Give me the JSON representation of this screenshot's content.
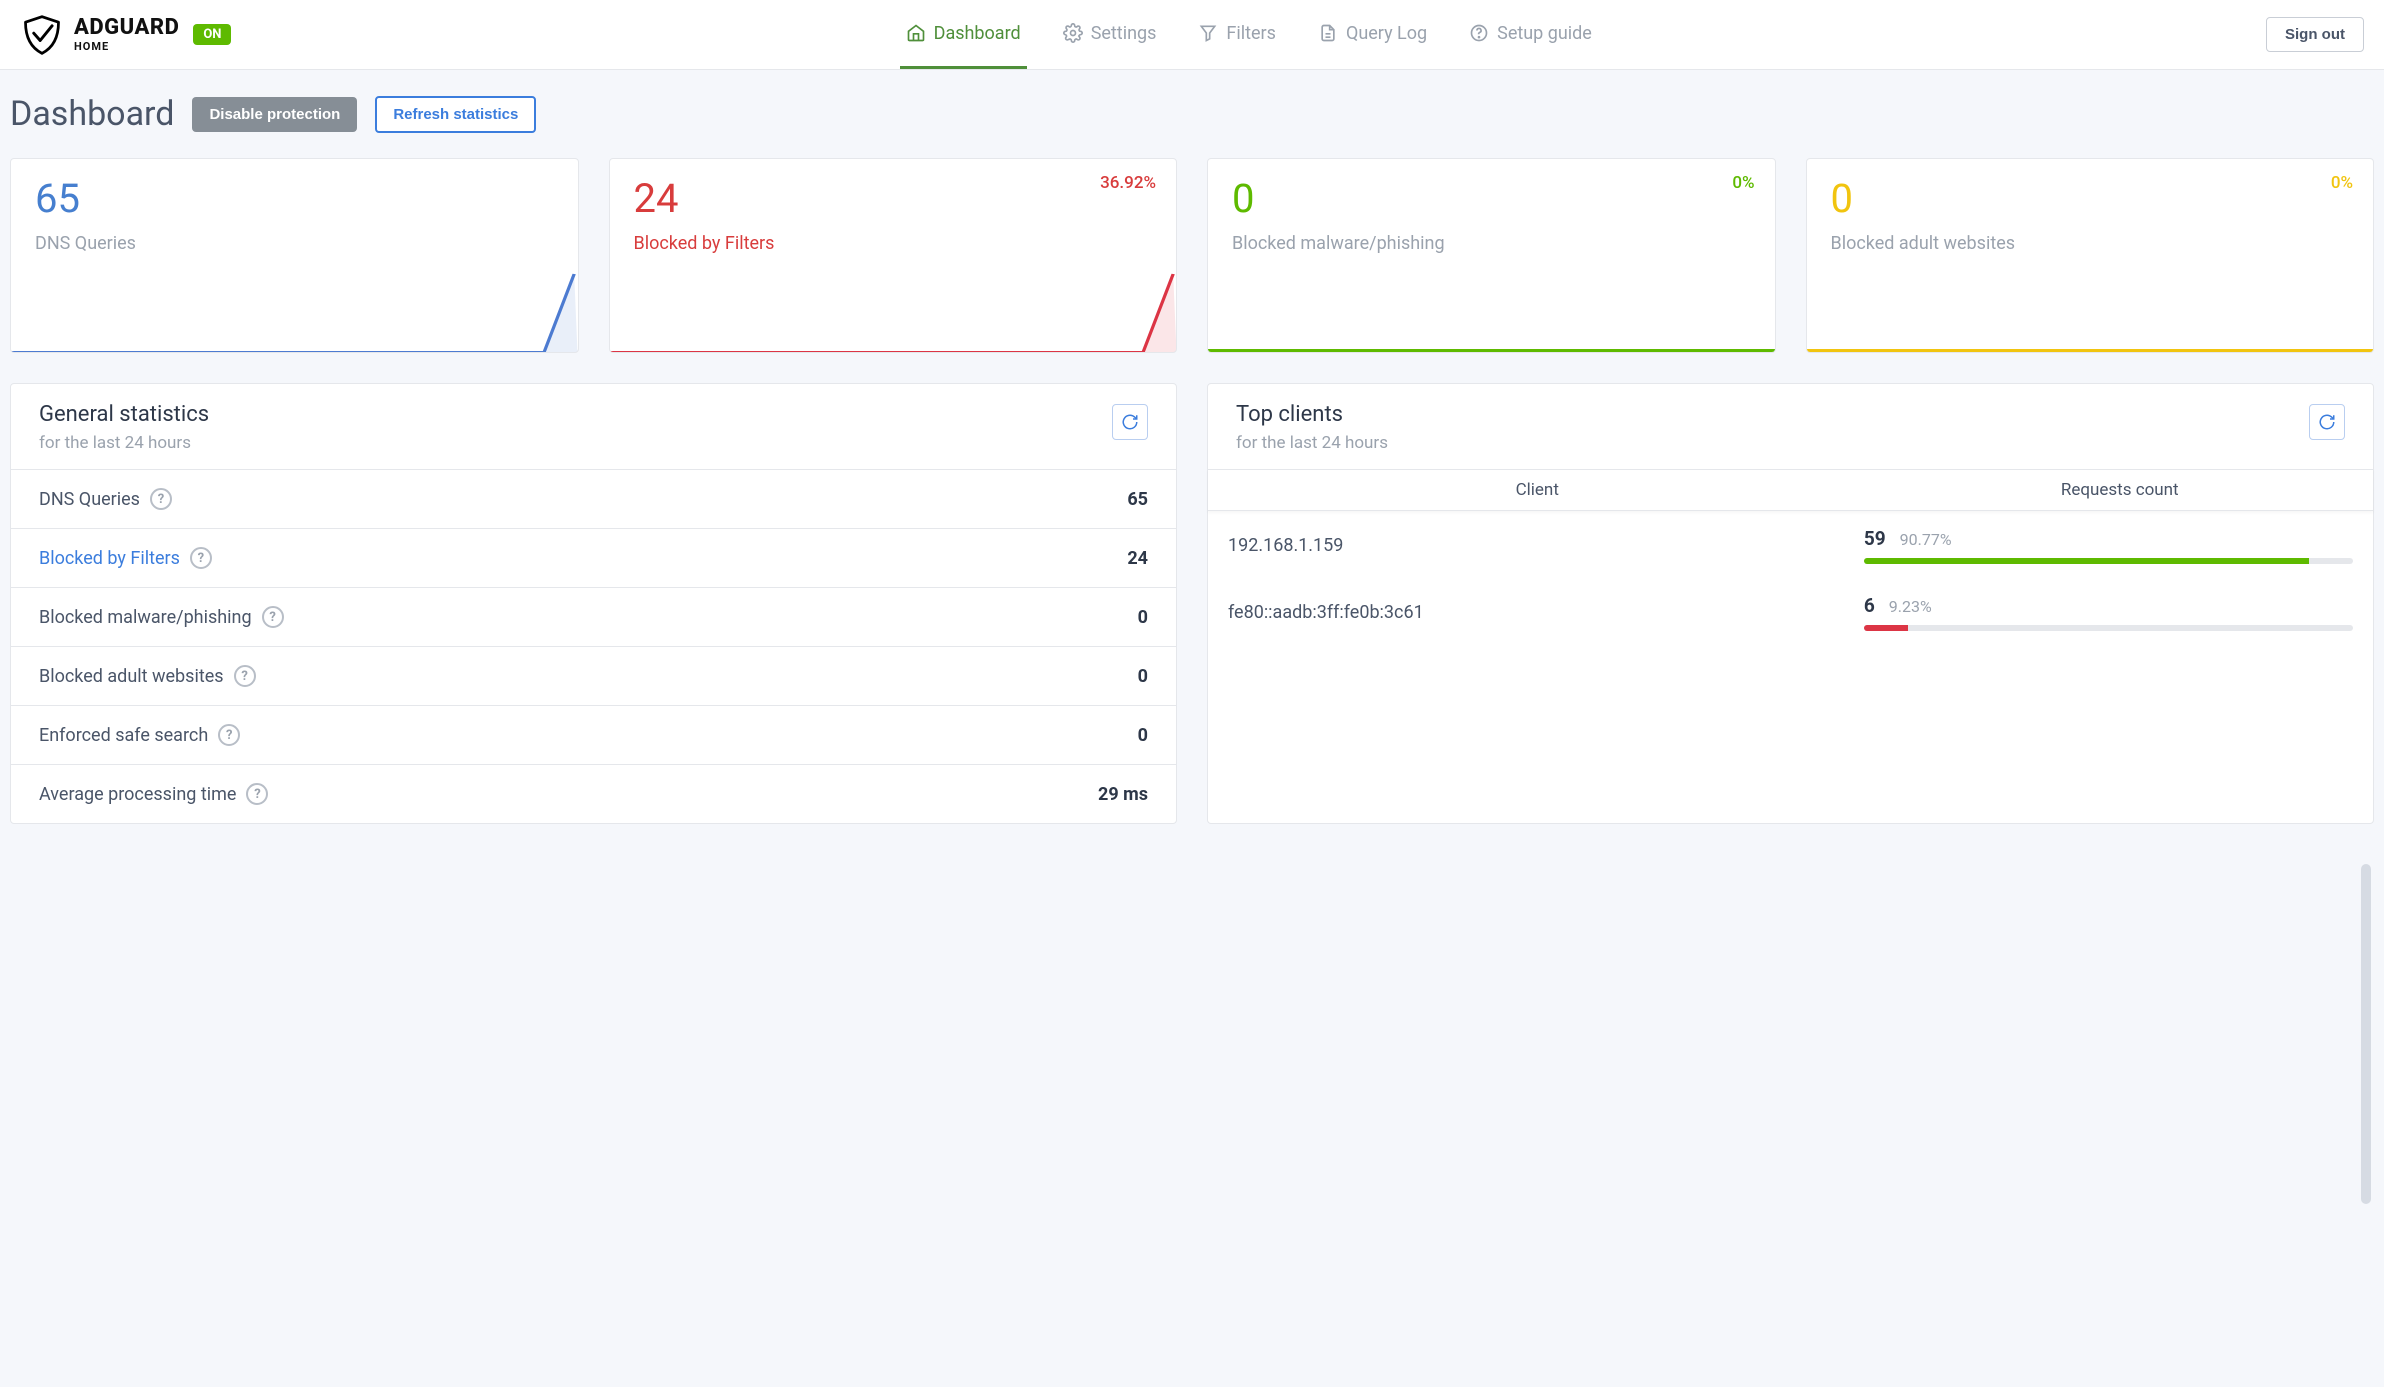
{
  "header": {
    "brand_title": "ADGUARD",
    "brand_sub": "HOME",
    "status": "ON",
    "nav": [
      {
        "label": "Dashboard",
        "active": true
      },
      {
        "label": "Settings",
        "active": false
      },
      {
        "label": "Filters",
        "active": false
      },
      {
        "label": "Query Log",
        "active": false
      },
      {
        "label": "Setup guide",
        "active": false
      }
    ],
    "sign_out": "Sign out"
  },
  "page": {
    "title": "Dashboard",
    "disable_btn": "Disable protection",
    "refresh_btn": "Refresh statistics"
  },
  "cards": [
    {
      "color": "blue",
      "value": "65",
      "label": "DNS Queries",
      "pct": ""
    },
    {
      "color": "red",
      "value": "24",
      "label": "Blocked by Filters",
      "pct": "36.92%"
    },
    {
      "color": "green",
      "value": "0",
      "label": "Blocked malware/phishing",
      "pct": "0%"
    },
    {
      "color": "yellow",
      "value": "0",
      "label": "Blocked adult websites",
      "pct": "0%"
    }
  ],
  "gen_stats": {
    "title": "General statistics",
    "subtitle": "for the last 24 hours",
    "rows": [
      {
        "label": "DNS Queries",
        "value": "65",
        "link": false
      },
      {
        "label": "Blocked by Filters",
        "value": "24",
        "link": true
      },
      {
        "label": "Blocked malware/phishing",
        "value": "0",
        "link": false
      },
      {
        "label": "Blocked adult websites",
        "value": "0",
        "link": false
      },
      {
        "label": "Enforced safe search",
        "value": "0",
        "link": false
      },
      {
        "label": "Average processing time",
        "value": "29 ms",
        "link": false
      }
    ]
  },
  "top_clients": {
    "title": "Top clients",
    "subtitle": "for the last 24 hours",
    "col_client": "Client",
    "col_requests": "Requests count",
    "rows": [
      {
        "client": "192.168.1.159",
        "count": "59",
        "pct": "90.77%",
        "bar_pct": 91,
        "bar_color": "#5eba00"
      },
      {
        "client": "fe80::aadb:3ff:fe0b:3c61",
        "count": "6",
        "pct": "9.23%",
        "bar_pct": 9,
        "bar_color": "#dc3545"
      }
    ]
  },
  "chart_data": [
    {
      "type": "line",
      "title": "DNS Queries",
      "value": 65,
      "pct": null,
      "color": "#467fcf"
    },
    {
      "type": "line",
      "title": "Blocked by Filters",
      "value": 24,
      "pct": 36.92,
      "color": "#d83c3c"
    },
    {
      "type": "line",
      "title": "Blocked malware/phishing",
      "value": 0,
      "pct": 0,
      "color": "#5eba00"
    },
    {
      "type": "line",
      "title": "Blocked adult websites",
      "value": 0,
      "pct": 0,
      "color": "#f1c40f"
    }
  ]
}
